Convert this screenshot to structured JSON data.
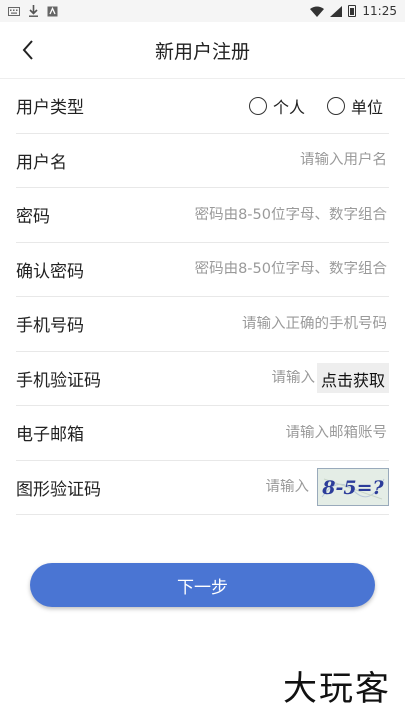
{
  "status_bar": {
    "icons": [
      "keyboard-icon",
      "download-icon",
      "alert-icon",
      "wifi-icon",
      "signal-icon",
      "battery-icon"
    ],
    "time": "11:25"
  },
  "header": {
    "title": "新用户注册",
    "back_icon": "chevron-left-icon"
  },
  "form": {
    "user_type": {
      "label": "用户类型",
      "options": [
        "个人",
        "单位"
      ]
    },
    "username": {
      "label": "用户名",
      "placeholder": "请输入用户名",
      "value": ""
    },
    "password": {
      "label": "密码",
      "placeholder": "密码由8-50位字母、数字组合",
      "value": ""
    },
    "confirm_password": {
      "label": "确认密码",
      "placeholder": "密码由8-50位字母、数字组合",
      "value": ""
    },
    "phone": {
      "label": "手机号码",
      "placeholder": "请输入正确的手机号码",
      "value": ""
    },
    "sms_code": {
      "label": "手机验证码",
      "placeholder": "请输入",
      "value": "",
      "button": "点击获取"
    },
    "email": {
      "label": "电子邮箱",
      "placeholder": "请输入邮箱账号",
      "value": ""
    },
    "captcha": {
      "label": "图形验证码",
      "placeholder": "请输入",
      "value": "",
      "image_text": "8-5=?"
    }
  },
  "next_button": "下一步",
  "watermark": "大玩客",
  "colors": {
    "primary": "#4a75d3",
    "divider": "#e8e8e8",
    "placeholder": "#9a9a9a"
  }
}
